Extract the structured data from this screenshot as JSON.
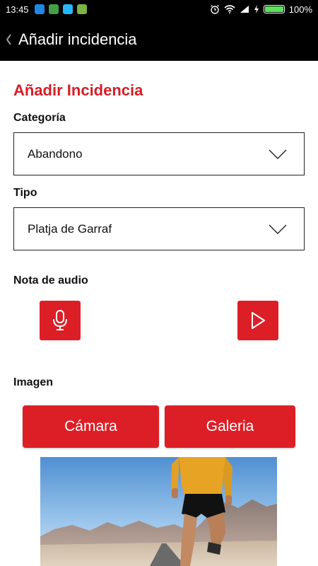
{
  "status_bar": {
    "time": "13:45",
    "battery_percent": "100%",
    "battery_level": 1.0,
    "icons": [
      "notification-icon",
      "notification-icon",
      "notification-icon",
      "notification-icon",
      "alarm-icon",
      "wifi-icon",
      "signal-icon",
      "charging-icon",
      "battery-icon"
    ]
  },
  "app_bar": {
    "back_icon": "chevron-left-icon",
    "title": "Añadir incidencia"
  },
  "form": {
    "heading": "Añadir Incidencia",
    "category": {
      "label": "Categoría",
      "value": "Abandono"
    },
    "type": {
      "label": "Tipo",
      "value": "Platja de Garraf"
    },
    "audio": {
      "label": "Nota de audio",
      "record_icon": "microphone-icon",
      "play_icon": "play-icon"
    },
    "image": {
      "label": "Imagen",
      "camera_label": "Cámara",
      "gallery_label": "Galeria"
    }
  },
  "colors": {
    "accent": "#dc1f27",
    "heading": "#d61f26",
    "bar": "#000000",
    "battery": "#5be35b"
  }
}
